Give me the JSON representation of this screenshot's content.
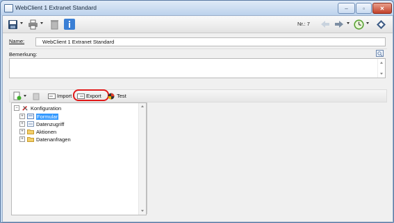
{
  "window": {
    "title": "WebClient 1 Extranet Standard",
    "controls": {
      "minimize": "–",
      "maximize": "▫",
      "close": "✕"
    }
  },
  "toolbar": {
    "nr_label": "Nr.: 7",
    "icons": [
      "save-icon",
      "print-icon",
      "delete-icon",
      "info-icon",
      "back-icon",
      "forward-icon",
      "history-icon",
      "options-icon"
    ]
  },
  "form": {
    "name_label": "Name:",
    "name_value": "WebClient 1 Extranet Standard",
    "bemerkung_label": "Bemerkung:",
    "bemerkung_value": ""
  },
  "subtoolbar": {
    "import_label": "Import",
    "export_label": "Export",
    "test_label": "Test"
  },
  "tree": {
    "root": "Konfiguration",
    "children": [
      "Formular",
      "Datenzugriff",
      "Aktionen",
      "Datenanfragen"
    ],
    "selected": "Formular",
    "expand_glyph": "+",
    "collapse_glyph": "−"
  },
  "colors": {
    "accent": "#3399ff",
    "highlight": "#e11919",
    "close": "#c2412a"
  }
}
